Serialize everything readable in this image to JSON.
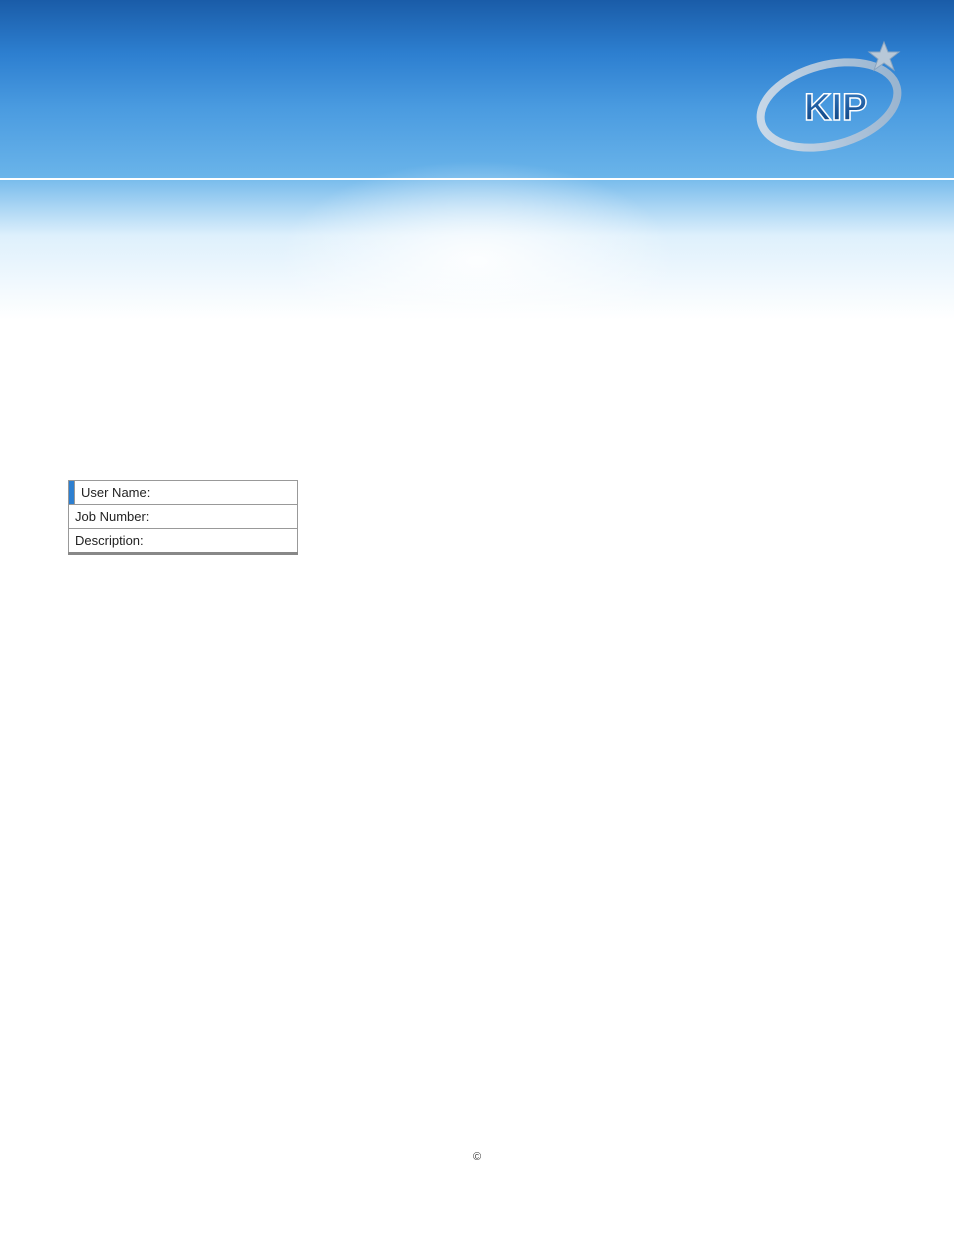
{
  "logo": {
    "text": "KIP"
  },
  "form": {
    "rows": [
      {
        "label": "User Name:"
      },
      {
        "label": "Job Number:"
      },
      {
        "label": "Description:"
      }
    ]
  },
  "footer": {
    "copyright": "©"
  }
}
